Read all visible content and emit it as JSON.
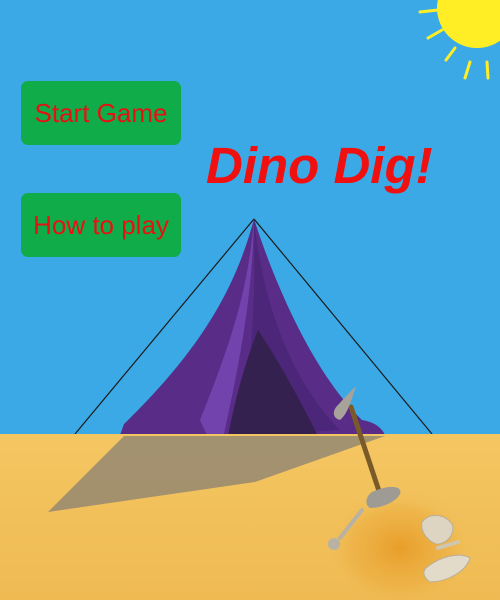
{
  "game": {
    "title": "Dino Dig!",
    "buttons": {
      "start_label": "Start Game",
      "howto_label": "How to play"
    }
  },
  "colors": {
    "sky": "#3aa9e5",
    "sand": "#f1c15c",
    "sand_dark": "#e0a73a",
    "button_bg": "#11ac4a",
    "button_text": "#e51212",
    "title_text": "#f01010",
    "tent_main": "#582c87",
    "tent_light": "#6e40a8",
    "tent_door": "#34214f",
    "sun": "#ffee25",
    "shadow": "#8f8573"
  },
  "icons": [
    "sun-icon",
    "tent-illustration",
    "shovel-icon",
    "dinosaur-bone-icon",
    "fossil-icon"
  ]
}
